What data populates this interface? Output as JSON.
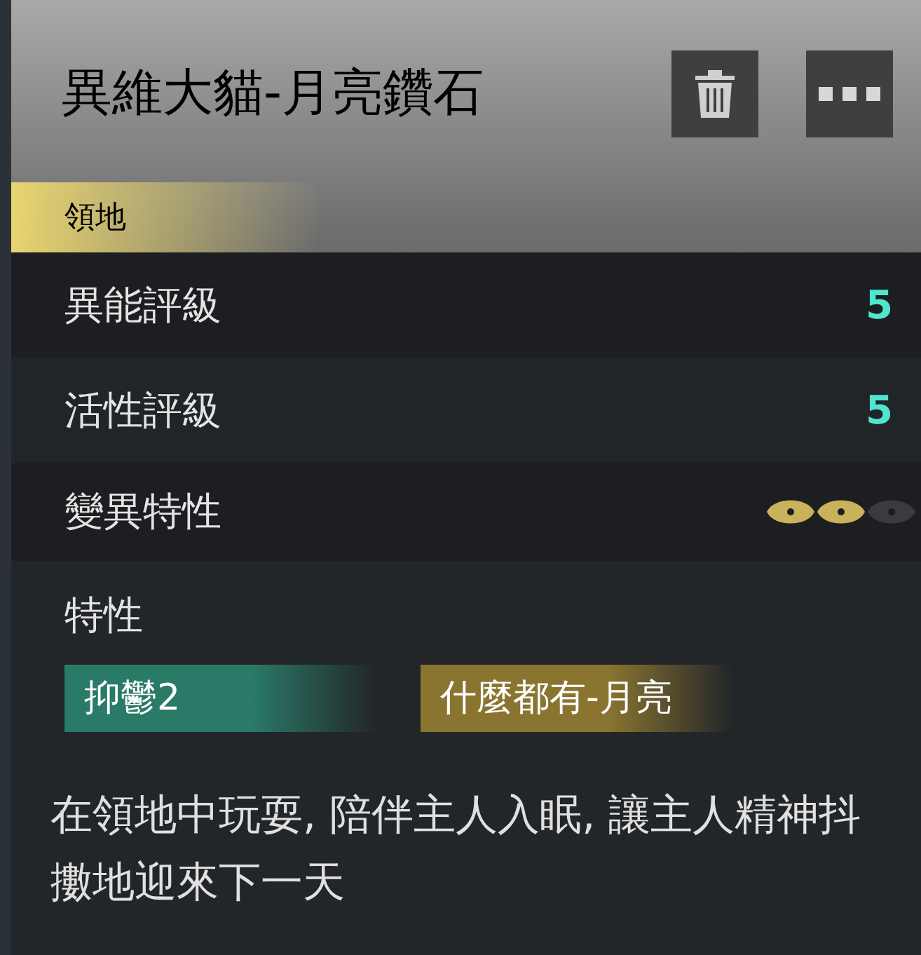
{
  "header": {
    "title": "異維大貓-月亮鑽石"
  },
  "tab": {
    "label": "領地",
    "selected": true
  },
  "ratings": [
    {
      "label": "異能評級",
      "value": "5"
    },
    {
      "label": "活性評級",
      "value": "5"
    }
  ],
  "mutation": {
    "label": "變異特性",
    "stars": 2
  },
  "traits": {
    "label": "特性",
    "tags": [
      {
        "text": "抑鬱2",
        "color": "#2a7a68"
      },
      {
        "text": "什麼都有-月亮",
        "color": "#8a7530"
      }
    ]
  },
  "description": "在領地中玩耍, 陪伴主人入眠, 讓主人精神抖擻地迎來下一天"
}
